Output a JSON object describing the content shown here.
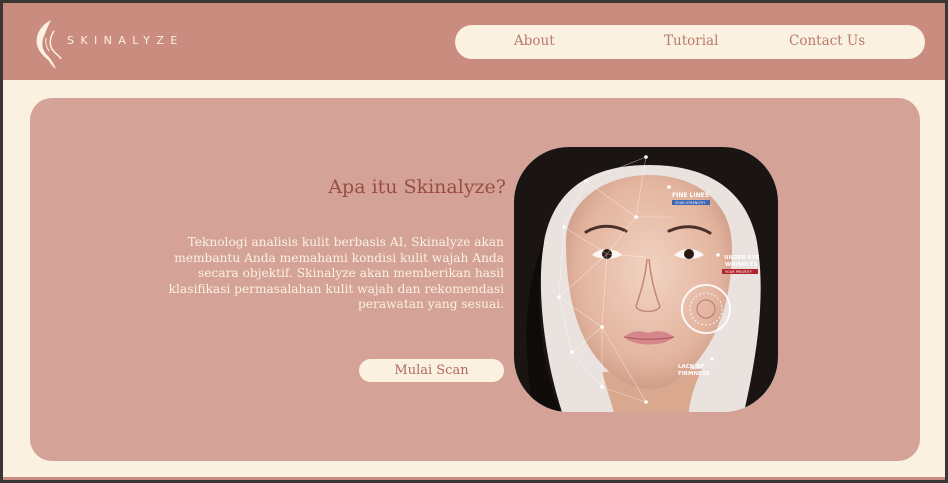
{
  "brand": {
    "name": "SKINALYZE"
  },
  "nav": {
    "about": "About",
    "tutorial": "Tutorial",
    "contact": "Contact Us"
  },
  "hero": {
    "title": "Apa itu Skinalyze?",
    "description": "Teknologi analisis kulit berbasis AI, Skinalyze akan membantu Anda memahami kondisi kulit wajah Anda secara objektif. Skinalyze akan memberikan hasil klasifikasi permasalahan kulit wajah dan rekomendasi perawatan yang sesuai.",
    "cta": "Mulai Scan"
  },
  "photo_labels": {
    "fine_lines": "FINE LINES",
    "fine_lines_tag": "YOUR STRENGTH",
    "under_eye_1": "UNDER-EYE",
    "under_eye_2": "WRINKLES",
    "under_eye_tag": "YOUR PRIORITY",
    "firmness_1": "LACK OF",
    "firmness_2": "FIRMNESS"
  },
  "colors": {
    "header": "#cb8c80",
    "card": "#d4a297",
    "cream": "#fbf1e1",
    "title": "#9a4e43",
    "tag_blue": "#3f67b3",
    "tag_red": "#b3262c"
  }
}
